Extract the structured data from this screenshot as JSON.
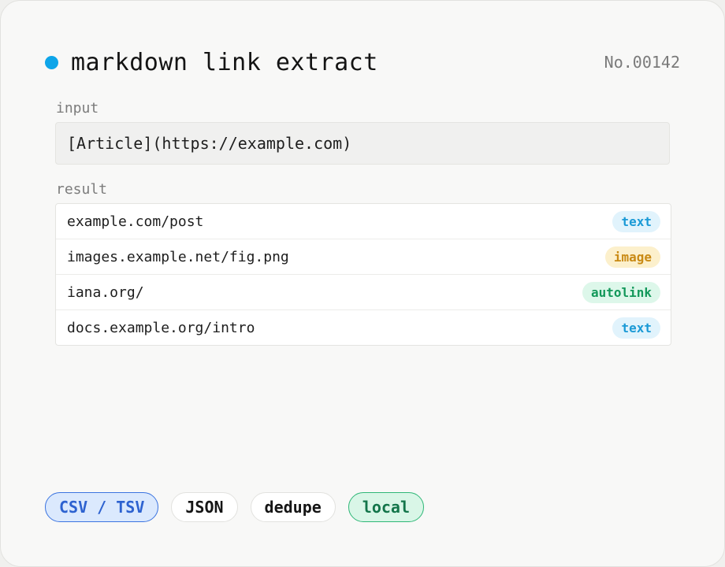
{
  "header": {
    "title": "markdown link extract",
    "record_no": "No.00142"
  },
  "input": {
    "label": "input",
    "value": "[Article](https://example.com)"
  },
  "result": {
    "label": "result",
    "rows": [
      {
        "url": "example.com/post",
        "kind": "text"
      },
      {
        "url": "images.example.net/fig.png",
        "kind": "image"
      },
      {
        "url": "iana.org/",
        "kind": "autolink"
      },
      {
        "url": "docs.example.org/intro",
        "kind": "text"
      }
    ]
  },
  "chips": [
    {
      "label": "CSV / TSV",
      "state": "selected-blue"
    },
    {
      "label": "JSON",
      "state": "neutral"
    },
    {
      "label": "dedupe",
      "state": "neutral"
    },
    {
      "label": "local",
      "state": "selected-green"
    }
  ],
  "colors": {
    "status_dot": "#0ea5e9",
    "tag_text": "#1b9ad6",
    "tag_image": "#c98a14",
    "tag_autolink": "#13985a"
  }
}
